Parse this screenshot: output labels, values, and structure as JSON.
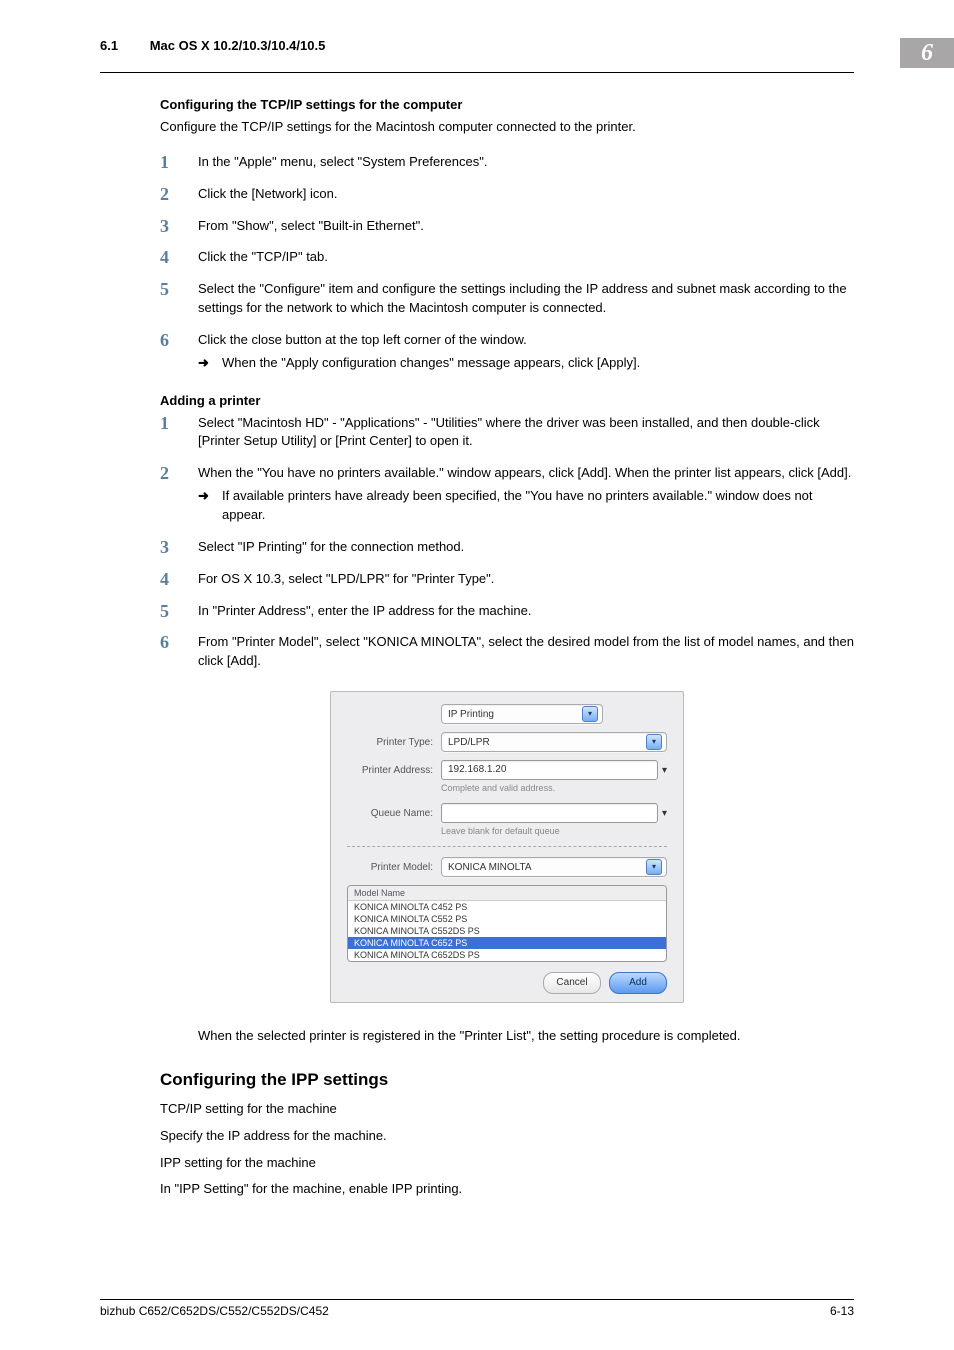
{
  "header": {
    "section_number": "6.1",
    "section_title": "Mac OS X 10.2/10.3/10.4/10.5",
    "chapter_badge": "6"
  },
  "section_a": {
    "title": "Configuring the TCP/IP settings for the computer",
    "intro": "Configure the TCP/IP settings for the Macintosh computer connected to the printer.",
    "steps": [
      {
        "text": "In the \"Apple\" menu, select \"System Preferences\"."
      },
      {
        "text": "Click the [Network] icon."
      },
      {
        "text": "From \"Show\", select \"Built-in Ethernet\"."
      },
      {
        "text": "Click the \"TCP/IP\" tab."
      },
      {
        "text": "Select the \"Configure\" item and configure the settings including the IP address and subnet mask according to the settings for the network to which the Macintosh computer is connected."
      },
      {
        "text": "Click the close button at the top left corner of the window.",
        "sub": "When the \"Apply configuration changes\" message appears, click [Apply]."
      }
    ]
  },
  "section_b": {
    "title": "Adding a printer",
    "steps": [
      {
        "text": "Select \"Macintosh HD\" - \"Applications\" - \"Utilities\" where the driver was been installed, and then double-click [Printer Setup Utility] or [Print Center] to open it."
      },
      {
        "text": "When the \"You have no printers available.\" window appears, click [Add]. When the printer list appears, click [Add].",
        "sub": "If available printers have already been specified, the \"You have no printers available.\" window does not appear."
      },
      {
        "text": "Select \"IP Printing\" for the connection method."
      },
      {
        "text": "For OS X 10.3, select \"LPD/LPR\" for \"Printer Type\"."
      },
      {
        "text": "In \"Printer Address\", enter the IP address for the machine."
      },
      {
        "text": "From \"Printer Model\", select \"KONICA MINOLTA\", select the desired model from the list of model names, and then click [Add]."
      }
    ],
    "post_note": "When the selected printer is registered in the \"Printer List\", the setting procedure is completed."
  },
  "screenshot": {
    "top_combo": "IP Printing",
    "printer_type_label": "Printer Type:",
    "printer_type_value": "LPD/LPR",
    "printer_address_label": "Printer Address:",
    "printer_address_value": "192.168.1.20",
    "printer_address_help": "Complete and valid address.",
    "queue_name_label": "Queue Name:",
    "queue_name_value": "",
    "queue_name_help": "Leave blank for default queue",
    "printer_model_label": "Printer Model:",
    "printer_model_value": "KONICA MINOLTA",
    "list_header": "Model Name",
    "list_items": [
      "KONICA MINOLTA C452 PS",
      "KONICA MINOLTA C552 PS",
      "KONICA MINOLTA C552DS PS",
      "KONICA MINOLTA C652 PS",
      "KONICA MINOLTA C652DS PS"
    ],
    "selected_index": 3,
    "cancel_label": "Cancel",
    "add_label": "Add"
  },
  "section_c": {
    "heading": "Configuring the IPP settings",
    "lines": [
      "TCP/IP setting for the machine",
      "Specify the IP address for the machine.",
      "IPP setting for the machine",
      "In \"IPP Setting\" for the machine, enable IPP printing."
    ]
  },
  "footer": {
    "left": "bizhub C652/C652DS/C552/C552DS/C452",
    "right": "6-13"
  }
}
